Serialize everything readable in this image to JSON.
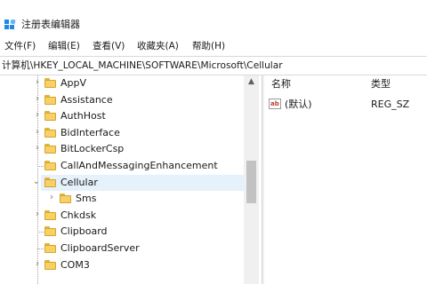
{
  "window": {
    "title": "注册表编辑器",
    "accent_color": "#0078d7"
  },
  "menu": {
    "items": [
      {
        "label": "文件(F)"
      },
      {
        "label": "编辑(E)"
      },
      {
        "label": "查看(V)"
      },
      {
        "label": "收藏夹(A)"
      },
      {
        "label": "帮助(H)"
      }
    ]
  },
  "address": {
    "path": "计算机\\HKEY_LOCAL_MACHINE\\SOFTWARE\\Microsoft\\Cellular"
  },
  "tree": {
    "items": [
      {
        "label": "AppV",
        "expander": "collapsed",
        "indent": 0
      },
      {
        "label": "Assistance",
        "expander": "collapsed",
        "indent": 0
      },
      {
        "label": "AuthHost",
        "expander": "collapsed",
        "indent": 0
      },
      {
        "label": "BidInterface",
        "expander": "collapsed",
        "indent": 0
      },
      {
        "label": "BitLockerCsp",
        "expander": "collapsed",
        "indent": 0
      },
      {
        "label": "CallAndMessagingEnhancement",
        "expander": "none",
        "indent": 0
      },
      {
        "label": "Cellular",
        "expander": "expanded",
        "indent": 0,
        "selected": true
      },
      {
        "label": "Sms",
        "expander": "collapsed",
        "indent": 1
      },
      {
        "label": "Chkdsk",
        "expander": "collapsed",
        "indent": 0
      },
      {
        "label": "Clipboard",
        "expander": "none",
        "indent": 0
      },
      {
        "label": "ClipboardServer",
        "expander": "none",
        "indent": 0
      },
      {
        "label": "COM3",
        "expander": "collapsed",
        "indent": 0
      }
    ],
    "selected_color": "#e5f1fb"
  },
  "list": {
    "columns": {
      "name": "名称",
      "type": "类型"
    },
    "values": [
      {
        "icon": "string-value-icon",
        "icon_text": "ab",
        "name": "(默认)",
        "type": "REG_SZ"
      }
    ]
  }
}
